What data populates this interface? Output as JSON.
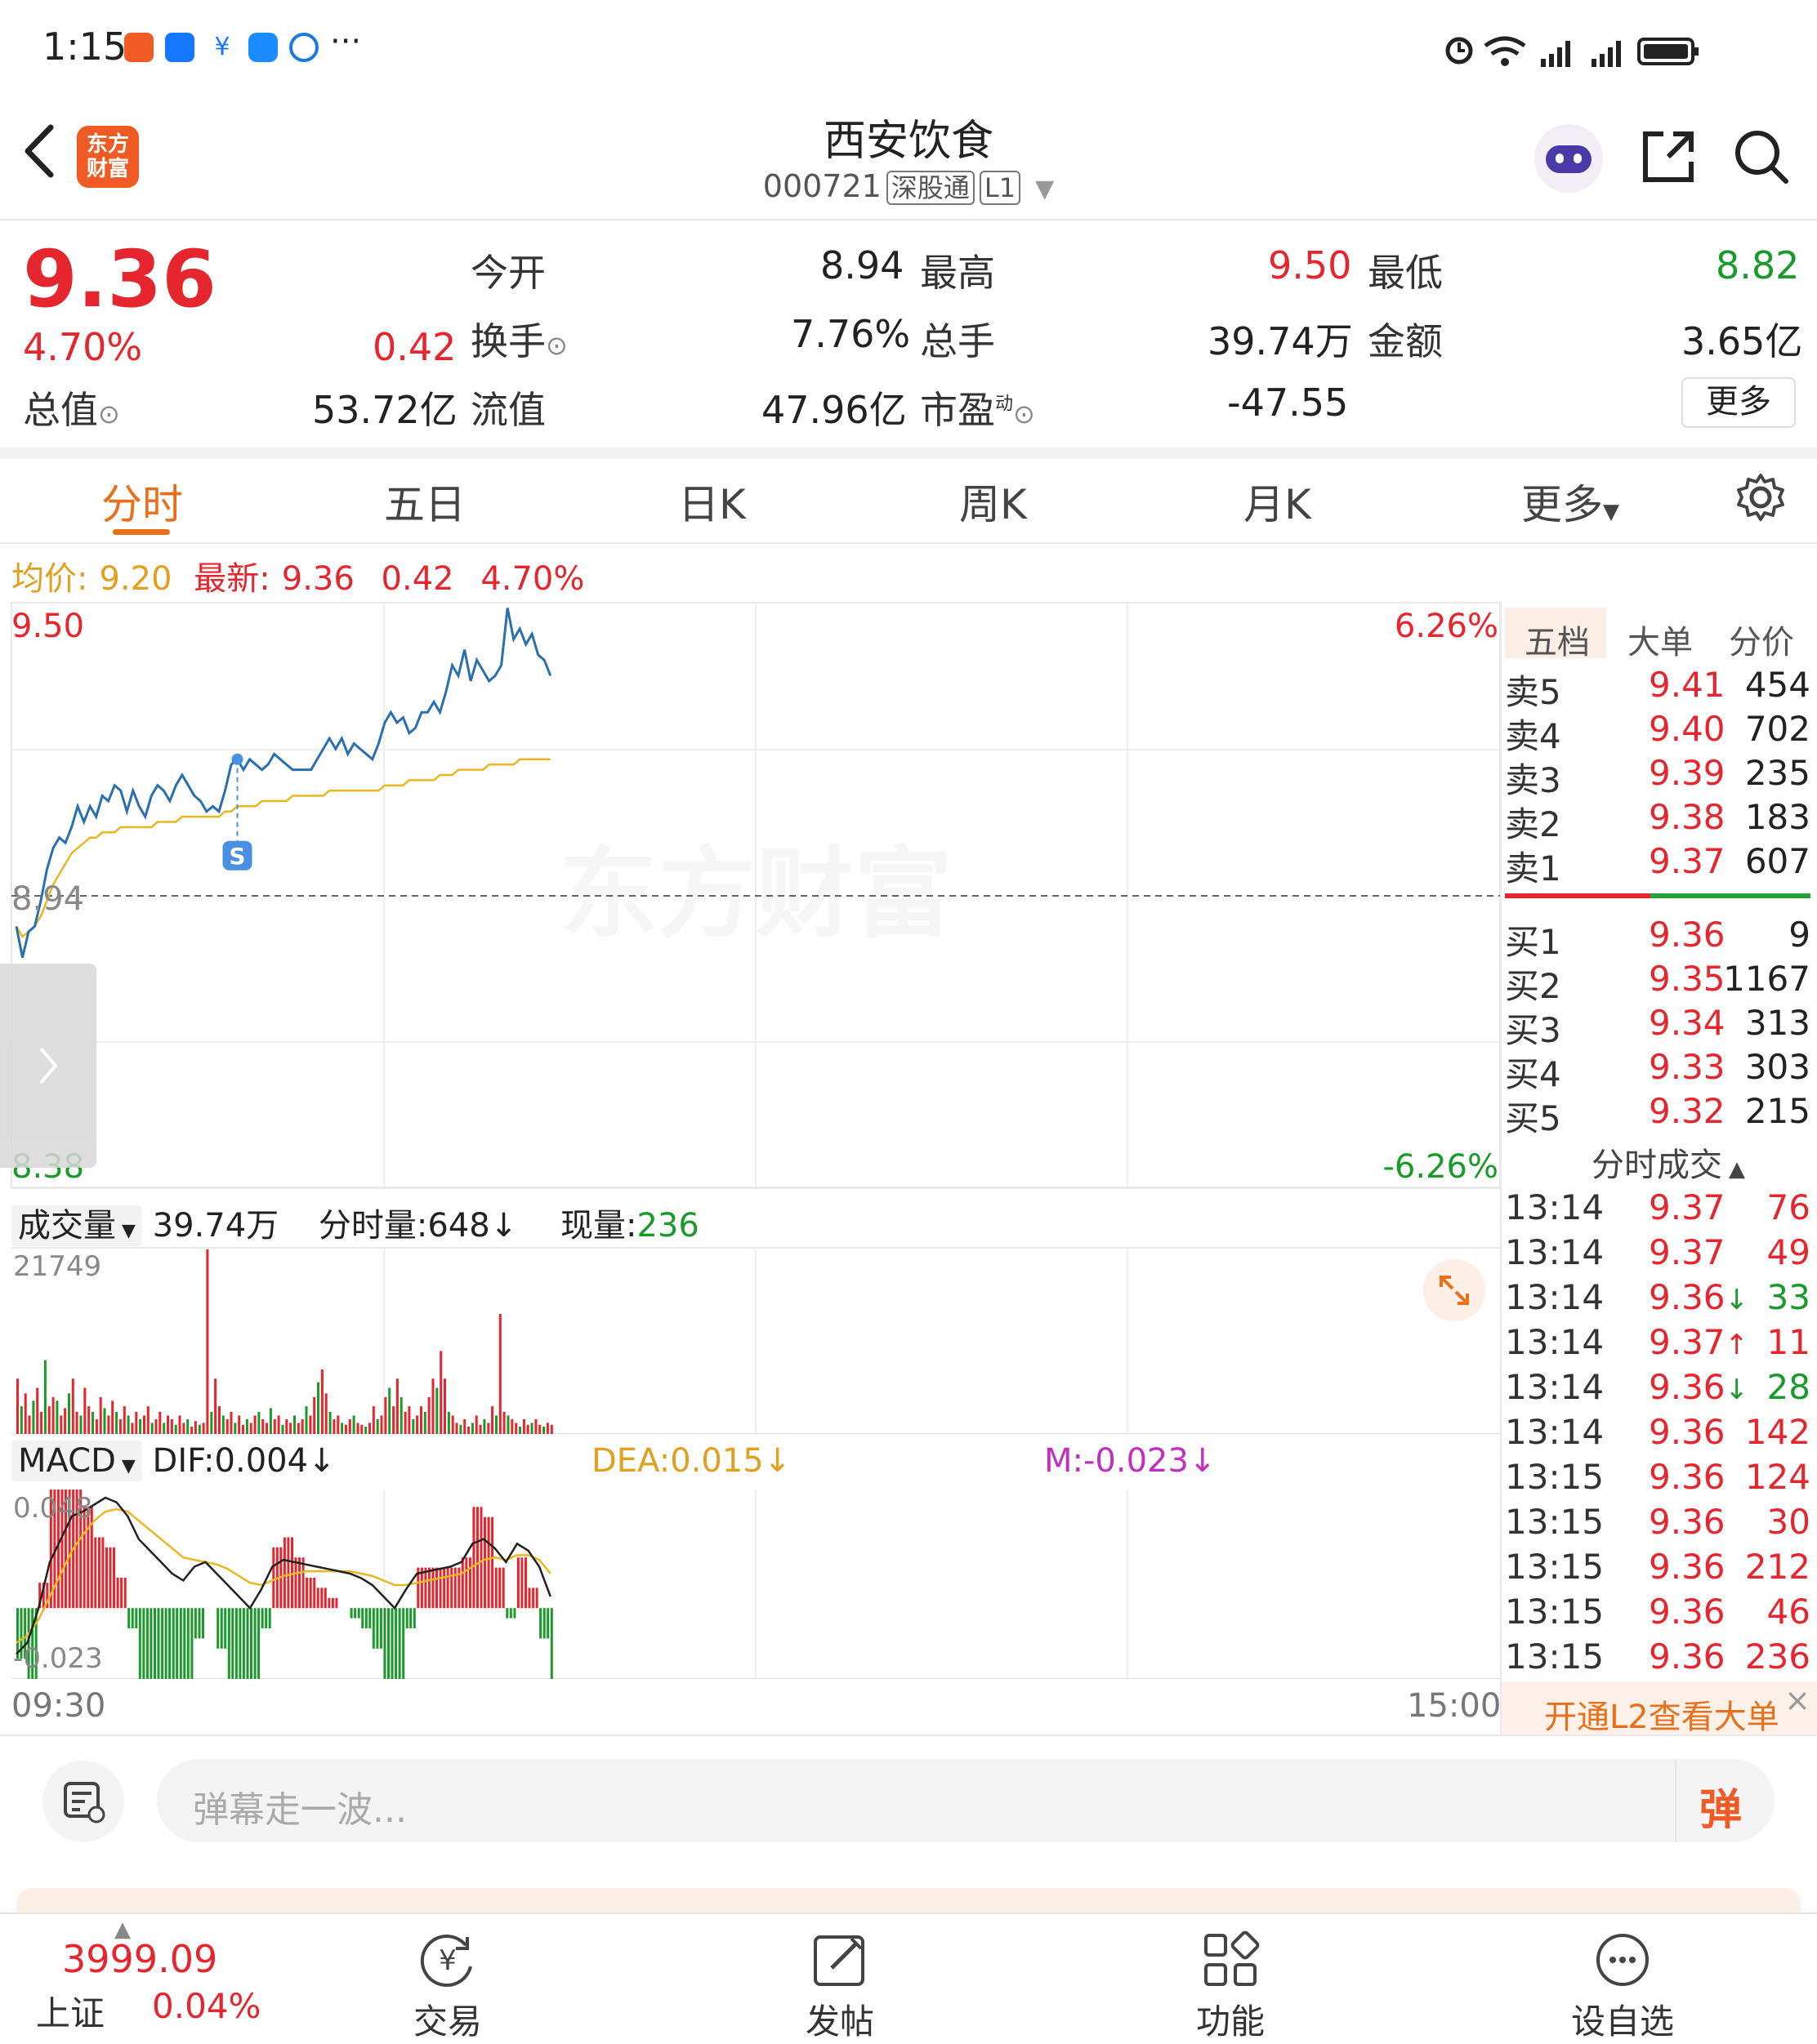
{
  "status_bar": {
    "time": "1:15",
    "more": "···",
    "icons": [
      "alarm-icon",
      "wifi-icon",
      "signal-icon",
      "signal-icon",
      "battery-icon"
    ]
  },
  "header": {
    "back_icon": "chevron-left-icon",
    "logo_text": "东方\n财富",
    "title": "西安饮食",
    "code": "000721",
    "tag_exchange": "深股通",
    "tag_level": "L1",
    "share_icon": "share-icon",
    "search_icon": "search-icon"
  },
  "quote": {
    "price": "9.36",
    "change_pct": "4.70%",
    "change": "0.42",
    "open_label": "今开",
    "open": "8.94",
    "high_label": "最高",
    "high": "9.50",
    "low_label": "最低",
    "low": "8.82",
    "turnover_label": "换手",
    "turnover": "7.76%",
    "volume_label": "总手",
    "volume": "39.74万",
    "amount_label": "金额",
    "amount": "3.65亿",
    "mcap_label": "总值",
    "mcap": "53.72亿",
    "float_label": "流值",
    "float": "47.96亿",
    "pe_label": "市盈",
    "pe_sup": "动",
    "pe": "-47.55",
    "more": "更多"
  },
  "tabs": [
    "分时",
    "五日",
    "日K",
    "周K",
    "月K",
    "更多"
  ],
  "chart_header": {
    "avg_label": "均价:",
    "avg": "9.20",
    "latest_label": "最新:",
    "latest": "9.36",
    "change": "0.42",
    "change_pct": "4.70%"
  },
  "chart_data": {
    "type": "line",
    "price_axis": {
      "top": "9.50",
      "base": "8.94",
      "bottom": "8.38"
    },
    "pct_axis": {
      "top": "6.26%",
      "bottom": "-6.26%"
    },
    "time_axis": {
      "start": "09:30",
      "end": "15:00"
    },
    "watermark": "东方财富",
    "marker": "S",
    "price_series": [
      8.88,
      8.82,
      8.87,
      8.88,
      8.93,
      8.99,
      9.03,
      9.05,
      9.04,
      9.07,
      9.11,
      9.08,
      9.11,
      9.09,
      9.13,
      9.12,
      9.15,
      9.14,
      9.1,
      9.14,
      9.11,
      9.09,
      9.13,
      9.15,
      9.14,
      9.12,
      9.15,
      9.17,
      9.15,
      9.13,
      9.12,
      9.1,
      9.11,
      9.1,
      9.14,
      9.19,
      9.2,
      9.18,
      9.2,
      9.19,
      9.18,
      9.19,
      9.21,
      9.2,
      9.19,
      9.18,
      9.18,
      9.18,
      9.18,
      9.2,
      9.22,
      9.24,
      9.22,
      9.24,
      9.21,
      9.23,
      9.22,
      9.21,
      9.2,
      9.23,
      9.27,
      9.29,
      9.27,
      9.28,
      9.25,
      9.26,
      9.29,
      9.29,
      9.31,
      9.29,
      9.33,
      9.38,
      9.36,
      9.41,
      9.35,
      9.39,
      9.37,
      9.35,
      9.36,
      9.38,
      9.49,
      9.43,
      9.45,
      9.42,
      9.44,
      9.4,
      9.39,
      9.36
    ],
    "avg_series": [
      8.88,
      8.86,
      8.87,
      8.88,
      8.9,
      8.93,
      8.96,
      8.98,
      9.0,
      9.02,
      9.03,
      9.04,
      9.05,
      9.05,
      9.06,
      9.06,
      9.06,
      9.07,
      9.07,
      9.07,
      9.07,
      9.07,
      9.07,
      9.08,
      9.08,
      9.08,
      9.08,
      9.09,
      9.09,
      9.09,
      9.09,
      9.09,
      9.09,
      9.09,
      9.1,
      9.1,
      9.11,
      9.11,
      9.11,
      9.11,
      9.12,
      9.12,
      9.12,
      9.12,
      9.12,
      9.13,
      9.13,
      9.13,
      9.13,
      9.13,
      9.13,
      9.14,
      9.14,
      9.14,
      9.14,
      9.14,
      9.14,
      9.14,
      9.14,
      9.14,
      9.15,
      9.15,
      9.15,
      9.15,
      9.16,
      9.16,
      9.16,
      9.16,
      9.16,
      9.17,
      9.17,
      9.17,
      9.18,
      9.18,
      9.18,
      9.18,
      9.18,
      9.19,
      9.19,
      9.19,
      9.19,
      9.19,
      9.2,
      9.2,
      9.2,
      9.2,
      9.2,
      9.2
    ],
    "volume_header": {
      "label": "成交量",
      "total": "39.74万",
      "tick_label": "分时量:",
      "tick": "648",
      "now_label": "现量:",
      "now": "236"
    },
    "volume_max_label": "21749",
    "volume_series": [
      0.3,
      0.15,
      0.22,
      0.1,
      0.18,
      0.25,
      0.12,
      0.4,
      0.15,
      0.2,
      0.18,
      0.1,
      0.14,
      0.22,
      0.3,
      0.12,
      0.1,
      0.25,
      0.15,
      0.12,
      0.08,
      0.2,
      0.14,
      0.1,
      0.18,
      0.12,
      0.08,
      0.15,
      0.1,
      0.06,
      0.12,
      0.08,
      0.1,
      0.15,
      0.06,
      0.08,
      0.12,
      0.06,
      0.1,
      0.08,
      0.05,
      0.1,
      0.06,
      0.08,
      0.04,
      0.07,
      0.05,
      0.06,
      1.0,
      0.12,
      0.3,
      0.15,
      0.1,
      0.08,
      0.12,
      0.06,
      0.1,
      0.05,
      0.08,
      0.06,
      0.1,
      0.12,
      0.08,
      0.06,
      0.14,
      0.08,
      0.1,
      0.05,
      0.08,
      0.06,
      0.1,
      0.06,
      0.08,
      0.15,
      0.1,
      0.2,
      0.28,
      0.35,
      0.22,
      0.12,
      0.08,
      0.1,
      0.06,
      0.05,
      0.08,
      0.1,
      0.06,
      0.05,
      0.04,
      0.06,
      0.15,
      0.08,
      0.1,
      0.2,
      0.25,
      0.15,
      0.3,
      0.2,
      0.12,
      0.15,
      0.08,
      0.1,
      0.15,
      0.12,
      0.2,
      0.3,
      0.25,
      0.45,
      0.3,
      0.12,
      0.1,
      0.06,
      0.05,
      0.08,
      0.04,
      0.06,
      0.1,
      0.05,
      0.08,
      0.06,
      0.15,
      0.1,
      0.65,
      0.12,
      0.1,
      0.08,
      0.06,
      0.04,
      0.08,
      0.05,
      0.06,
      0.08,
      0.05,
      0.04,
      0.06,
      0.05
    ],
    "macd_header": {
      "label": "MACD",
      "dif_label": "DIF:",
      "dif": "0.004",
      "dea_label": "DEA:",
      "dea": "0.015",
      "m_label": "M:",
      "m": "-0.023"
    },
    "macd_axis": {
      "top": "0.048",
      "bottom": "-0.023"
    },
    "dif_series": [
      -0.02,
      -0.015,
      0.0,
      0.02,
      0.03,
      0.04,
      0.042,
      0.045,
      0.048,
      0.046,
      0.04,
      0.03,
      0.025,
      0.02,
      0.015,
      0.012,
      0.018,
      0.02,
      0.015,
      0.01,
      0.005,
      0.0,
      0.008,
      0.018,
      0.021,
      0.02,
      0.019,
      0.018,
      0.017,
      0.016,
      0.015,
      0.013,
      0.01,
      0.005,
      0.0,
      0.008,
      0.015,
      0.016,
      0.017,
      0.018,
      0.02,
      0.028,
      0.03,
      0.026,
      0.02,
      0.028,
      0.025,
      0.018,
      0.005
    ],
    "dea_series": [
      -0.015,
      -0.012,
      -0.005,
      0.005,
      0.015,
      0.025,
      0.032,
      0.038,
      0.042,
      0.043,
      0.042,
      0.038,
      0.034,
      0.03,
      0.026,
      0.022,
      0.021,
      0.02,
      0.019,
      0.017,
      0.014,
      0.011,
      0.01,
      0.012,
      0.014,
      0.015,
      0.016,
      0.016,
      0.016,
      0.016,
      0.016,
      0.015,
      0.014,
      0.012,
      0.01,
      0.01,
      0.011,
      0.012,
      0.013,
      0.014,
      0.015,
      0.018,
      0.021,
      0.022,
      0.021,
      0.023,
      0.023,
      0.021,
      0.015
    ],
    "m_series": [
      -0.01,
      -0.015,
      0.005,
      0.03,
      0.03,
      0.03,
      0.02,
      0.014,
      0.012,
      0.006,
      -0.004,
      -0.016,
      -0.018,
      -0.02,
      -0.022,
      -0.02,
      -0.006,
      0.0,
      -0.008,
      -0.014,
      -0.018,
      -0.022,
      -0.004,
      0.012,
      0.014,
      0.01,
      0.006,
      0.004,
      0.002,
      0.0,
      -0.002,
      -0.004,
      -0.008,
      -0.014,
      -0.02,
      -0.004,
      0.008,
      0.008,
      0.008,
      0.008,
      0.01,
      0.02,
      0.018,
      0.008,
      -0.002,
      0.01,
      0.004,
      -0.006,
      -0.02
    ]
  },
  "order_book": {
    "tabs": [
      "五档",
      "大单",
      "分价"
    ],
    "asks": [
      {
        "label": "卖5",
        "price": "9.41",
        "vol": "454"
      },
      {
        "label": "卖4",
        "price": "9.40",
        "vol": "702"
      },
      {
        "label": "卖3",
        "price": "9.39",
        "vol": "235"
      },
      {
        "label": "卖2",
        "price": "9.38",
        "vol": "183"
      },
      {
        "label": "卖1",
        "price": "9.37",
        "vol": "607"
      }
    ],
    "bids": [
      {
        "label": "买1",
        "price": "9.36",
        "vol": "9"
      },
      {
        "label": "买2",
        "price": "9.35",
        "vol": "1167"
      },
      {
        "label": "买3",
        "price": "9.34",
        "vol": "313"
      },
      {
        "label": "买4",
        "price": "9.33",
        "vol": "303"
      },
      {
        "label": "买5",
        "price": "9.32",
        "vol": "215"
      }
    ],
    "ticks_title": "分时成交",
    "ticks": [
      {
        "time": "13:14",
        "price": "9.37",
        "arrow": "",
        "vol": "76",
        "dir": "up"
      },
      {
        "time": "13:14",
        "price": "9.37",
        "arrow": "",
        "vol": "49",
        "dir": "up"
      },
      {
        "time": "13:14",
        "price": "9.36",
        "arrow": "↓",
        "vol": "33",
        "dir": "down"
      },
      {
        "time": "13:14",
        "price": "9.37",
        "arrow": "↑",
        "vol": "11",
        "dir": "up"
      },
      {
        "time": "13:14",
        "price": "9.36",
        "arrow": "↓",
        "vol": "28",
        "dir": "down"
      },
      {
        "time": "13:14",
        "price": "9.36",
        "arrow": "",
        "vol": "142",
        "dir": "up"
      },
      {
        "time": "13:15",
        "price": "9.36",
        "arrow": "",
        "vol": "124",
        "dir": "up"
      },
      {
        "time": "13:15",
        "price": "9.36",
        "arrow": "",
        "vol": "30",
        "dir": "up"
      },
      {
        "time": "13:15",
        "price": "9.36",
        "arrow": "",
        "vol": "212",
        "dir": "up"
      },
      {
        "time": "13:15",
        "price": "9.36",
        "arrow": "",
        "vol": "46",
        "dir": "up"
      },
      {
        "time": "13:15",
        "price": "9.36",
        "arrow": "",
        "vol": "236",
        "dir": "up"
      }
    ],
    "l2_banner": "开通L2查看大单",
    "close": "×"
  },
  "danmu": {
    "placeholder": "弹幕走一波...",
    "send": "弹"
  },
  "bottom_bar": {
    "index_value": "3999.09",
    "index_name": "上证",
    "index_pct": "0.04%",
    "items": [
      {
        "label": "交易",
        "icon": "yen-trade-icon"
      },
      {
        "label": "发帖",
        "icon": "edit-post-icon"
      },
      {
        "label": "功能",
        "icon": "grid-icon"
      },
      {
        "label": "设自选",
        "icon": "more-dots-icon"
      }
    ]
  }
}
